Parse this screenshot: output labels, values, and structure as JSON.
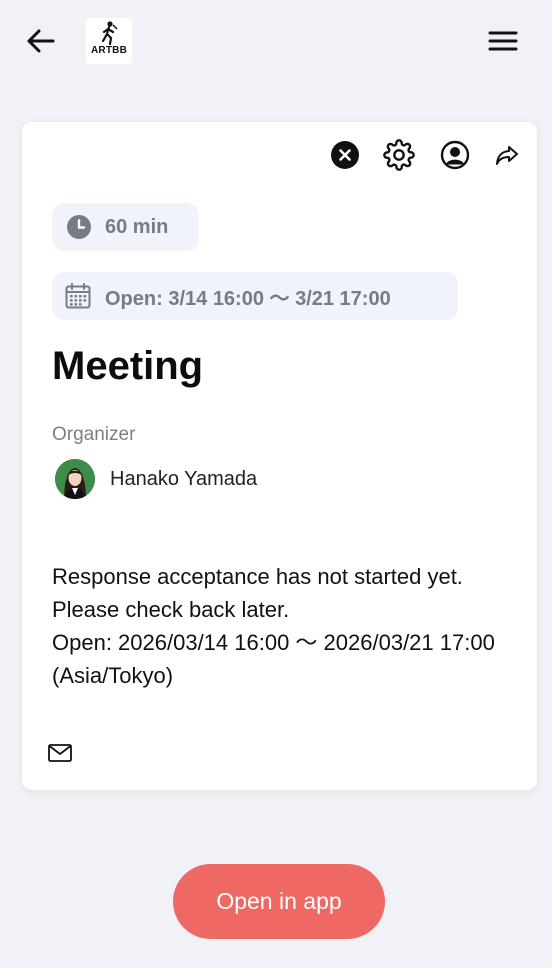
{
  "header": {
    "back_icon": "arrow-left-icon",
    "logo_text": "ARTBB",
    "menu_icon": "hamburger-menu-icon"
  },
  "card": {
    "actions": [
      {
        "name": "close",
        "icon": "close-circle-icon"
      },
      {
        "name": "settings",
        "icon": "gear-icon"
      },
      {
        "name": "profile",
        "icon": "user-circle-icon"
      },
      {
        "name": "share",
        "icon": "share-arrow-icon"
      }
    ],
    "duration": "60 min",
    "period": "Open: 3/14 16:00 〜 3/21 17:00",
    "title": "Meeting",
    "organizer_label": "Organizer",
    "organizer_name": "Hanako Yamada",
    "message": "Response acceptance has not started yet. Please check back later.\nOpen: 2026/03/14 16:00 〜 2026/03/21 17:00 (Asia/Tokyo)",
    "mail_icon": "mail-icon"
  },
  "cta": {
    "label": "Open in app"
  },
  "colors": {
    "background": "#f1f2f7",
    "pill_bg": "#f1f3fa",
    "pill_text": "#767b88",
    "cta": "#ee6864"
  }
}
